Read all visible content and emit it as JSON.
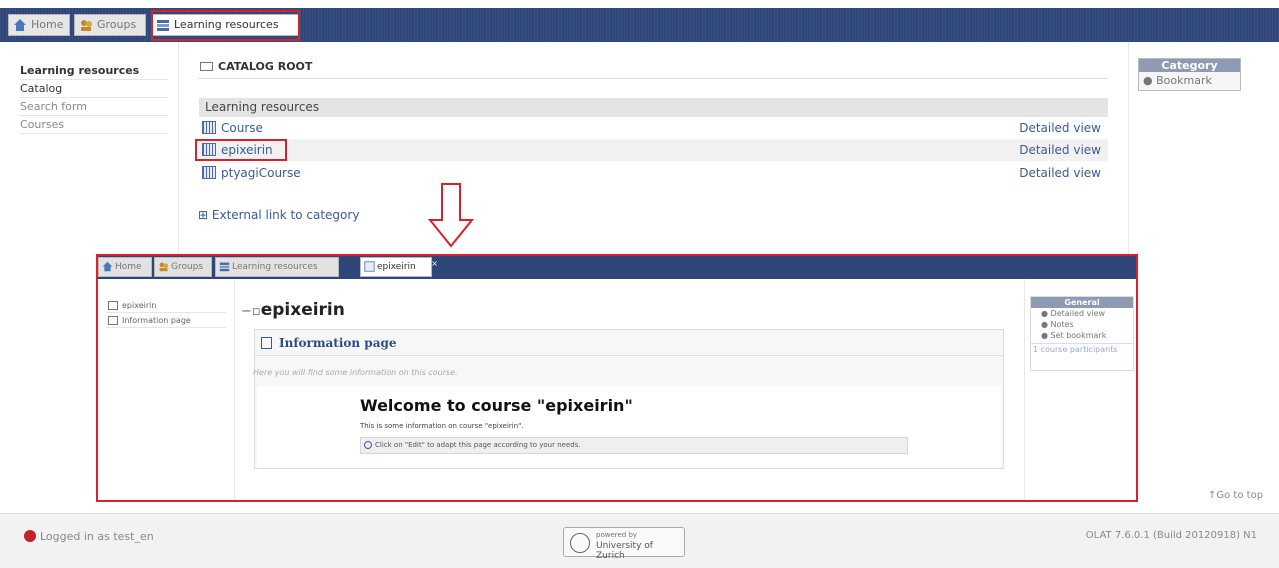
{
  "top_tabs": [
    {
      "label": "Home",
      "icon": "home-icon"
    },
    {
      "label": "Groups",
      "icon": "groups-icon"
    },
    {
      "label": "Learning resources",
      "icon": "learning-resources-icon"
    }
  ],
  "left_nav": {
    "heading": "Learning resources",
    "items": [
      "Catalog",
      "Search form",
      "Courses"
    ]
  },
  "catalog": {
    "title": "CATALOG ROOT",
    "section_header": "Learning resources",
    "rows": [
      {
        "name": "Course",
        "action": "Detailed view"
      },
      {
        "name": "epixeirin",
        "action": "Detailed view"
      },
      {
        "name": "ptyagiCourse",
        "action": "Detailed view"
      }
    ],
    "external_link": "External link to category"
  },
  "right_panel": {
    "header": "Category",
    "item": "Bookmark"
  },
  "inner": {
    "tabs": [
      "Home",
      "Groups",
      "Learning resources",
      "epixeirin"
    ],
    "side_items": [
      "epixeirin",
      "Information page"
    ],
    "course_title": "epixeirin",
    "box_header": "Information page",
    "box_subtitle": "Here you will find some information on this course.",
    "welcome": "Welcome to course \"epixeirin\"",
    "welcome_desc": "This is some information on course \"epixeirin\".",
    "hint": "Click on \"Edit\" to adapt this page according to your needs.",
    "right_panel": {
      "header": "General",
      "items": [
        "Detailed view",
        "Notes",
        "Set bookmark"
      ],
      "link": "1 course participants"
    }
  },
  "goto_top": "Go to top",
  "footer": {
    "login": "Logged in as test_en",
    "badge_line1": "powered by",
    "badge_line2": "University of Zurich",
    "build": "OLAT 7.6.0.1 (Build 20120918) N1"
  },
  "colors": {
    "accent_red": "#d6232b",
    "nav_blue": "#2f4678",
    "link_blue": "#3a5a9b"
  }
}
